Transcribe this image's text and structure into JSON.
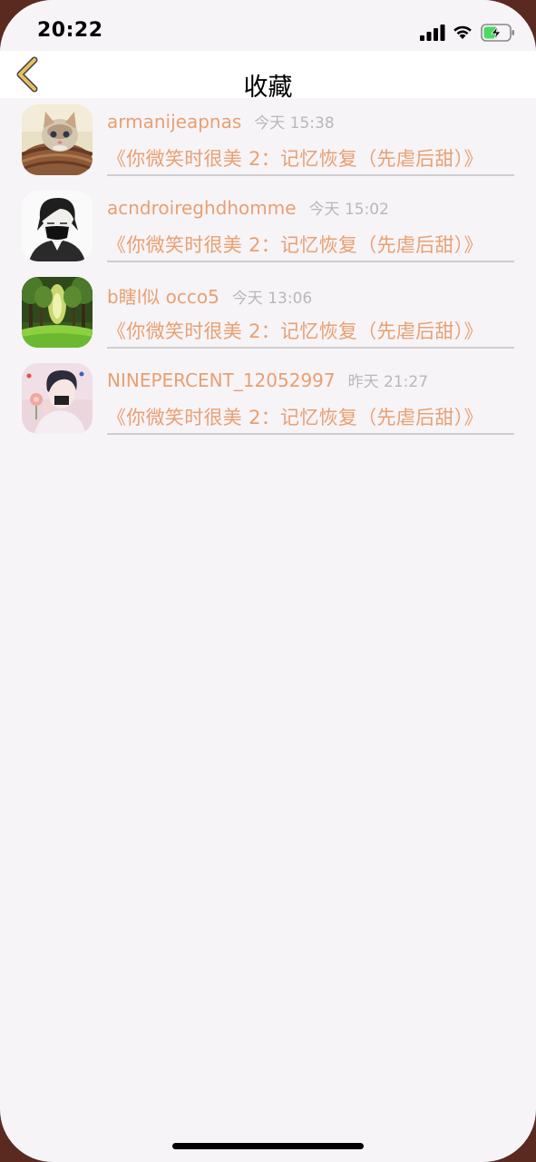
{
  "status_bar": {
    "time": "20:22"
  },
  "nav": {
    "title": "收藏",
    "back_icon": "chevron-left-icon",
    "back_icon_color": "#e8c060"
  },
  "favorites": [
    {
      "user": "armanijeapnas",
      "time": "今天 15:38",
      "title": "《你微笑时很美 2：记忆恢复（先虐后甜）》",
      "avatar": "kitten-avatar"
    },
    {
      "user": "acndroireghdhomme",
      "time": "今天 15:02",
      "title": "《你微笑时很美 2：记忆恢复（先虐后甜）》",
      "avatar": "masked-boy-avatar"
    },
    {
      "user": "b瞎l似 occo5",
      "time": "今天 13:06",
      "title": "《你微笑时很美 2：记忆恢复（先虐后甜）》",
      "avatar": "forest-avatar"
    },
    {
      "user": "NINEPERCENT_12052997",
      "time": "昨天 21:27",
      "title": "《你微笑时很美 2：记忆恢复（先虐后甜）》",
      "avatar": "anime-boy-avatar"
    }
  ],
  "colors": {
    "accent": "#e8a070",
    "meta_text": "#b8b8b8",
    "background": "#f7f4f8"
  }
}
